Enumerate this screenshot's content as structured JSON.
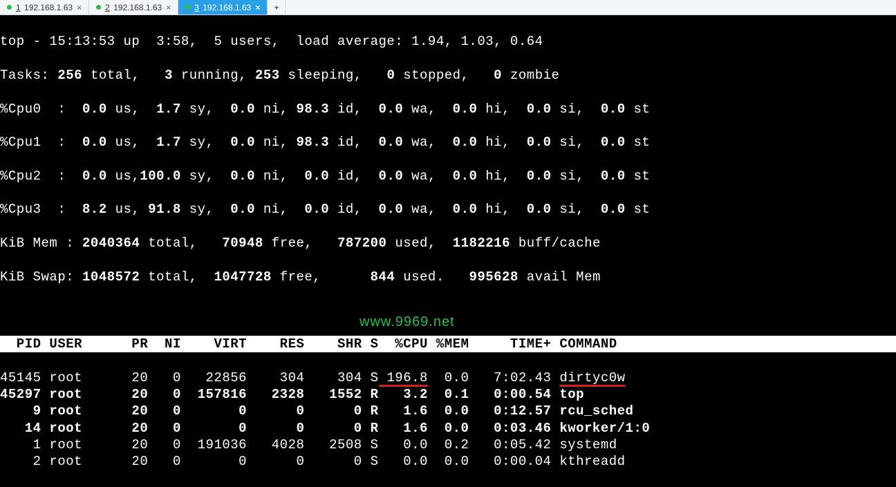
{
  "tabs": [
    {
      "index": "1",
      "label": "192.168.1.63",
      "active": false
    },
    {
      "index": "2",
      "label": "192.168.1.63",
      "active": false
    },
    {
      "index": "3",
      "label": "192.168.1.63",
      "active": true
    }
  ],
  "summary": {
    "line1_a": "top - 15:13:53 up  3:58,  ",
    "line1_b": "5 users,  ",
    "line1_c": "load average: 1.94, 1.03, 0.64",
    "tasks_label": "Tasks: ",
    "tasks_total": "256 ",
    "tasks_total_l": "total,   ",
    "tasks_run": "3 ",
    "tasks_run_l": "running, ",
    "tasks_sleep": "253 ",
    "tasks_sleep_l": "sleeping,   ",
    "tasks_stop": "0 ",
    "tasks_stop_l": "stopped,   ",
    "tasks_zomb": "0 ",
    "tasks_zomb_l": "zombie",
    "cpu0": "%Cpu0  :  ",
    "cpu1": "%Cpu1  :  ",
    "cpu2": "%Cpu2  :  ",
    "cpu3": "%Cpu3  :  ",
    "c0_us": "0.0 ",
    "c0_sy": "1.7 ",
    "c0_ni": "0.0 ",
    "c0_id": "98.3 ",
    "c0_wa": "0.0 ",
    "c0_hi": "0.0 ",
    "c0_si": "0.0 ",
    "c0_st": "0.0 ",
    "c1_us": "0.0 ",
    "c1_sy": "1.7 ",
    "c1_ni": "0.0 ",
    "c1_id": "98.3 ",
    "c1_wa": "0.0 ",
    "c1_hi": "0.0 ",
    "c1_si": "0.0 ",
    "c1_st": "0.0 ",
    "c2_us": "0.0 ",
    "c2_sy": "100.0 ",
    "c2_ni": "0.0 ",
    "c2_id": "0.0 ",
    "c2_wa": "0.0 ",
    "c2_hi": "0.0 ",
    "c2_si": "0.0 ",
    "c2_st": "0.0 ",
    "c3_us": "8.2 ",
    "c3_sy": "91.8 ",
    "c3_ni": "0.0 ",
    "c3_id": "0.0 ",
    "c3_wa": "0.0 ",
    "c3_hi": "0.0 ",
    "c3_si": "0.0 ",
    "c3_st": "0.0 ",
    "us_l": "us,  ",
    "sy_l": "sy,  ",
    "ni_l": "ni, ",
    "id_l": "id,  ",
    "wa_l": "wa,  ",
    "hi_l": "hi,  ",
    "si_l": "si,  ",
    "st_l": "st",
    "us_lc": "us,",
    "sy_lc": "sy,  ",
    "mem_label": "KiB Mem : ",
    "mem_total": "2040364 ",
    "mem_total_l": "total,   ",
    "mem_free": "70948 ",
    "mem_free_l": "free,   ",
    "mem_used": "787200 ",
    "mem_used_l": "used,  ",
    "mem_buff": "1182216 ",
    "mem_buff_l": "buff/cache",
    "swap_label": "KiB Swap: ",
    "swap_total": "1048572 ",
    "swap_total_l": "total,  ",
    "swap_free": "1047728 ",
    "swap_free_l": "free,      ",
    "swap_used": "844 ",
    "swap_used_l": "used.   ",
    "swap_avail": "995628 ",
    "swap_avail_l": "avail Mem"
  },
  "columns": "  PID USER      PR  NI    VIRT    RES    SHR S  %CPU %MEM     TIME+ COMMAND           ",
  "procs": [
    {
      "bold": false,
      "pid": "45145",
      "user": "root",
      "pr": "20",
      "ni": "0",
      "virt": "22856",
      "res": "304",
      "shr": "304",
      "s": "S",
      "cpu": "196.8",
      "mem": "0.0",
      "time": "7:02.43",
      "cmd": "dirtyc0w",
      "mark": true
    },
    {
      "bold": true,
      "pid": "45297",
      "user": "root",
      "pr": "20",
      "ni": "0",
      "virt": "157816",
      "res": "2328",
      "shr": "1552",
      "s": "R",
      "cpu": "3.2",
      "mem": "0.1",
      "time": "0:00.54",
      "cmd": "top"
    },
    {
      "bold": true,
      "pid": "9",
      "user": "root",
      "pr": "20",
      "ni": "0",
      "virt": "0",
      "res": "0",
      "shr": "0",
      "s": "R",
      "cpu": "1.6",
      "mem": "0.0",
      "time": "0:12.57",
      "cmd": "rcu_sched"
    },
    {
      "bold": true,
      "pid": "14",
      "user": "root",
      "pr": "20",
      "ni": "0",
      "virt": "0",
      "res": "0",
      "shr": "0",
      "s": "R",
      "cpu": "1.6",
      "mem": "0.0",
      "time": "0:03.46",
      "cmd": "kworker/1:0"
    },
    {
      "bold": false,
      "pid": "1",
      "user": "root",
      "pr": "20",
      "ni": "0",
      "virt": "191036",
      "res": "4028",
      "shr": "2508",
      "s": "S",
      "cpu": "0.0",
      "mem": "0.2",
      "time": "0:05.42",
      "cmd": "systemd"
    },
    {
      "bold": false,
      "pid": "2",
      "user": "root",
      "pr": "20",
      "ni": "0",
      "virt": "0",
      "res": "0",
      "shr": "0",
      "s": "S",
      "cpu": "0.0",
      "mem": "0.0",
      "time": "0:00.04",
      "cmd": "kthreadd"
    }
  ],
  "watermark": "www.9969.net"
}
